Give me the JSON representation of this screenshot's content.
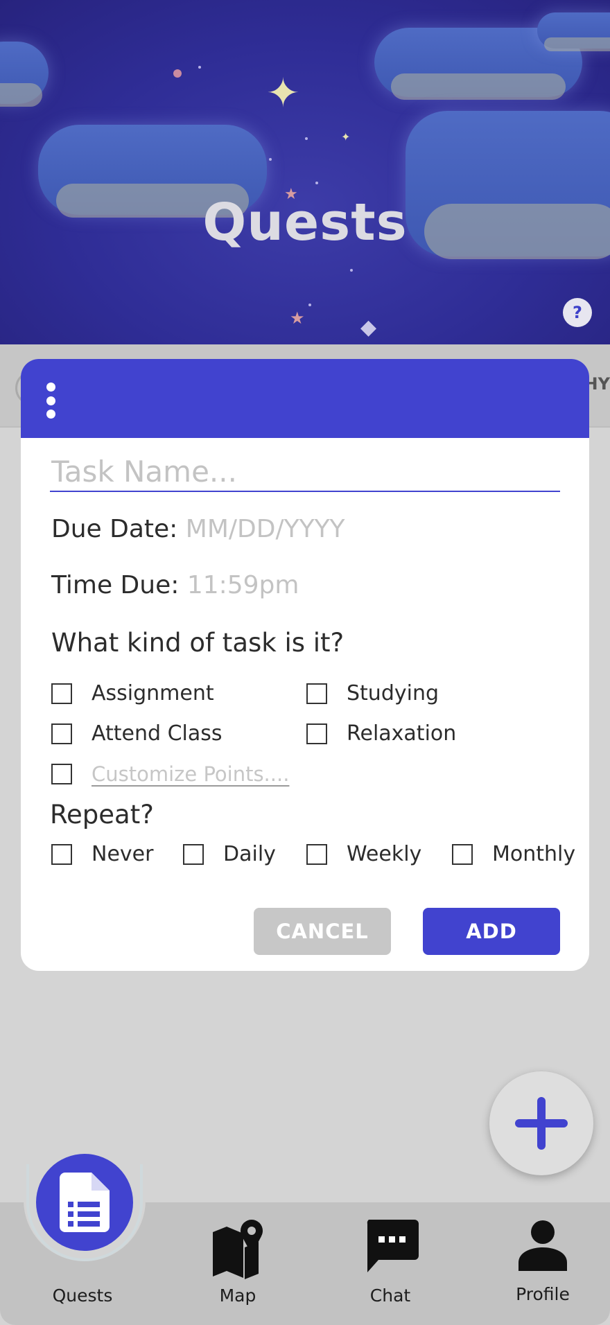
{
  "header": {
    "title": "Quests",
    "help_label": "?"
  },
  "background_strip": {
    "partial_text": "HY"
  },
  "task_form": {
    "task_name_placeholder": "Task Name...",
    "due_date_label": "Due Date:",
    "due_date_placeholder": "MM/DD/YYYY",
    "time_due_label": "Time Due:",
    "time_due_placeholder": "11:59pm",
    "task_type_question": "What kind of task is it?",
    "task_types": [
      "Assignment",
      "Studying",
      "Attend Class",
      "Relaxation"
    ],
    "customize_points_placeholder": "Customize Points....",
    "repeat_label": "Repeat?",
    "repeat_options": [
      "Never",
      "Daily",
      "Weekly",
      "Monthly"
    ],
    "cancel_label": "CANCEL",
    "add_label": "ADD"
  },
  "nav": {
    "items": [
      {
        "label": "Quests",
        "icon": "document-icon",
        "active": true
      },
      {
        "label": "Map",
        "icon": "map-pin-icon",
        "active": false
      },
      {
        "label": "Chat",
        "icon": "chat-icon",
        "active": false
      },
      {
        "label": "Profile",
        "icon": "person-icon",
        "active": false
      }
    ]
  },
  "colors": {
    "accent": "#4143cf",
    "header_bg": "#2f2d96",
    "page_bg": "#d4d4d4",
    "nav_bg": "#c2c2c2",
    "cancel_bg": "#c7c7c7"
  }
}
